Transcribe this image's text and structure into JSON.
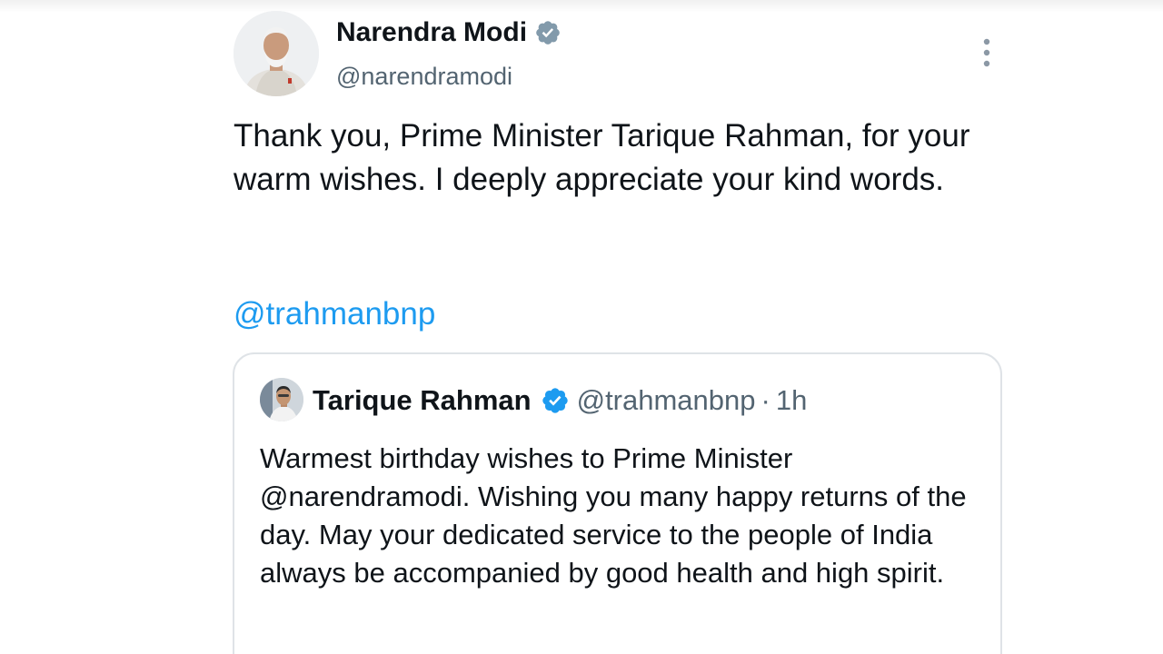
{
  "colors": {
    "accent": "#1d9bf0",
    "secondary_text": "#536471",
    "primary_text": "#0f1419",
    "card_border": "#dfe3e7"
  },
  "post": {
    "author_name": "Narendra Modi",
    "author_handle": "@narendramodi",
    "verified_icon": "verified-badge-icon",
    "more_icon": "more-options-icon",
    "text": "Thank you, Prime Minister Tarique Rahman, for your warm wishes. I deeply appreciate your kind words.",
    "mention": "@trahmanbnp"
  },
  "quoted_post": {
    "author_name": "Tarique Rahman",
    "author_handle": "@trahmanbnp",
    "separator": "·",
    "time": "1h",
    "text": "Warmest birthday wishes to Prime Minister @narendramodi. Wishing you many happy returns of the day. May your dedicated service to the people of India always be accompanied by good health and high spirit."
  }
}
